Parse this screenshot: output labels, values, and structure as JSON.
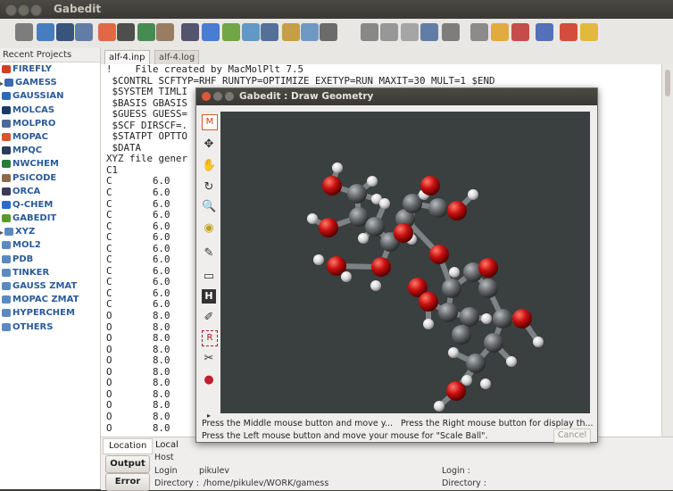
{
  "window": {
    "title": "Gabedit"
  },
  "toolbar": {
    "icons": [
      "GAMESS",
      "gaussian",
      "molcas",
      "molpro",
      "mopac",
      "mpqc",
      "nwchem",
      "psicode",
      "orca",
      "qchem",
      "gabedit",
      "xyz",
      "save",
      "open",
      "new",
      "print",
      "cut",
      "copy",
      "paste",
      "find",
      "find-replace",
      "insert",
      "draw",
      "molecule",
      "plot",
      "exit",
      "favorite"
    ]
  },
  "sidebar": {
    "header": "Recent Projects",
    "items": [
      {
        "label": "FIREFLY",
        "color": "#d04020"
      },
      {
        "label": "GAMESS",
        "color": "#3a6ab0",
        "expander": "▸"
      },
      {
        "label": "GAUSSIAN",
        "color": "#2a6ab8"
      },
      {
        "label": "MOLCAS",
        "color": "#1a3a6a"
      },
      {
        "label": "MOLPRO",
        "color": "#4a6a9a"
      },
      {
        "label": "MOPAC",
        "color": "#e0502a"
      },
      {
        "label": "MPQC",
        "color": "#2a3a5a"
      },
      {
        "label": "NWCHEM",
        "color": "#2a7a3a"
      },
      {
        "label": "PSICODE",
        "color": "#8a6a4a"
      },
      {
        "label": "ORCA",
        "color": "#3a3a5a"
      },
      {
        "label": "Q-CHEM",
        "color": "#2a6ad0"
      },
      {
        "label": "GABEDIT",
        "color": "#5a9a2a"
      },
      {
        "label": "XYZ",
        "color": "#5a8ac0",
        "expander": "▸"
      },
      {
        "label": "MOL2",
        "color": "#5a8ac0"
      },
      {
        "label": "PDB",
        "color": "#5a8ac0"
      },
      {
        "label": "TINKER",
        "color": "#5a8ac0"
      },
      {
        "label": "GAUSS ZMAT",
        "color": "#5a8ac0"
      },
      {
        "label": "MOPAC ZMAT",
        "color": "#5a8ac0"
      },
      {
        "label": "HYPERCHEM",
        "color": "#5a8ac0"
      },
      {
        "label": "OTHERS",
        "color": "#5a8ac0"
      }
    ]
  },
  "tabs": [
    "alf-4.inp",
    "alf-4.log"
  ],
  "editor": {
    "lines": [
      "!    File created by MacMolPlt 7.5",
      " $CONTRL SCFTYP=RHF RUNTYP=OPTIMIZE EXETYP=RUN MAXIT=30 MULT=1 $END",
      " $SYSTEM TIMLI",
      " $BASIS GBASIS",
      " $GUESS GUESS=",
      " $SCF DIRSCF=.",
      " $STATPT OPTTO",
      " $DATA",
      "XYZ file gener",
      "C1",
      "C       6.0",
      "C       6.0",
      "C       6.0",
      "C       6.0",
      "C       6.0",
      "C       6.0",
      "C       6.0",
      "C       6.0",
      "C       6.0",
      "C       6.0",
      "C       6.0",
      "C       6.0",
      "O       8.0",
      "O       8.0",
      "O       8.0",
      "O       8.0",
      "O       8.0",
      "O       8.0",
      "O       8.0",
      "O       8.0",
      "O       8.0",
      "O       8.0",
      "O       8.0"
    ]
  },
  "bottom": {
    "tab_location": "Location",
    "tab_local": "Local",
    "output_label": "Output",
    "error_label": "Error",
    "host_label": "Host",
    "login_label": "Login",
    "login_value": "pikulev",
    "directory_label": "Directory :",
    "directory_value": "/home/pikulev/WORK/gamess",
    "login_label2": "Login :",
    "directory_label2": "Directory :"
  },
  "dialog": {
    "title": "Gabedit : Draw Geometry",
    "status_middle": "Press the Middle mouse button and move y...",
    "status_right": "Press the Right mouse button for display th...",
    "status_left": "Press the Left mouse button and move your mouse for \"Scale Ball\".",
    "cancel_label": "Cancel",
    "tools": [
      "M",
      "✥",
      "✋",
      "↻",
      "🔍",
      "◉",
      "✎",
      "▭",
      "H",
      "✐",
      "R",
      "✂",
      "●",
      "▸"
    ]
  }
}
